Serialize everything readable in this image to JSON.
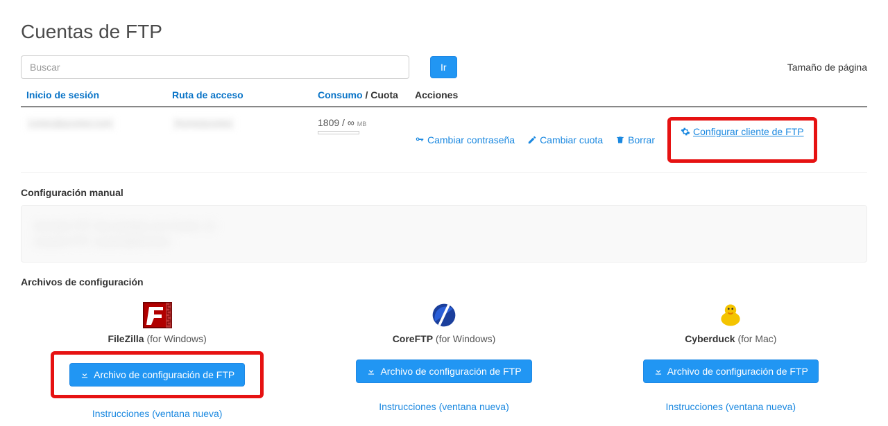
{
  "title": "Cuentas de FTP",
  "search": {
    "placeholder": "Buscar",
    "go_label": "Ir"
  },
  "page_size_label": "Tamaño de página",
  "table": {
    "headers": {
      "login": "Inicio de sesión",
      "path": "Ruta de acceso",
      "usage": "Consumo",
      "quota": "Cuota",
      "actions": "Acciones"
    },
    "row": {
      "login": "cortes@pcortes.com",
      "path": "/home/pcortes",
      "usage_value": "1809",
      "usage_sep": "/",
      "usage_inf": "∞",
      "usage_unit": "MB"
    }
  },
  "actions": {
    "change_password": "Cambiar contraseña",
    "change_quota": "Cambiar cuota",
    "delete": "Borrar",
    "configure_client": " Configurar cliente de FTP"
  },
  "manual": {
    "title": "Configuración manual",
    "placeholder_line1": "Servidor FTP: ftp.example.com Puerto: 21",
    "placeholder_line2": "Usuario FTP: usuario@dominio"
  },
  "config_files": {
    "title": "Archivos de configuración",
    "download_label": "Archivo de configuración de FTP",
    "instructions_label": "Instrucciones (ventana nueva)",
    "clients": [
      {
        "name": "FileZilla",
        "platform": "(for Windows)"
      },
      {
        "name": "CoreFTP",
        "platform": "(for Windows)"
      },
      {
        "name": "Cyberduck",
        "platform": "(for Mac)"
      }
    ]
  }
}
